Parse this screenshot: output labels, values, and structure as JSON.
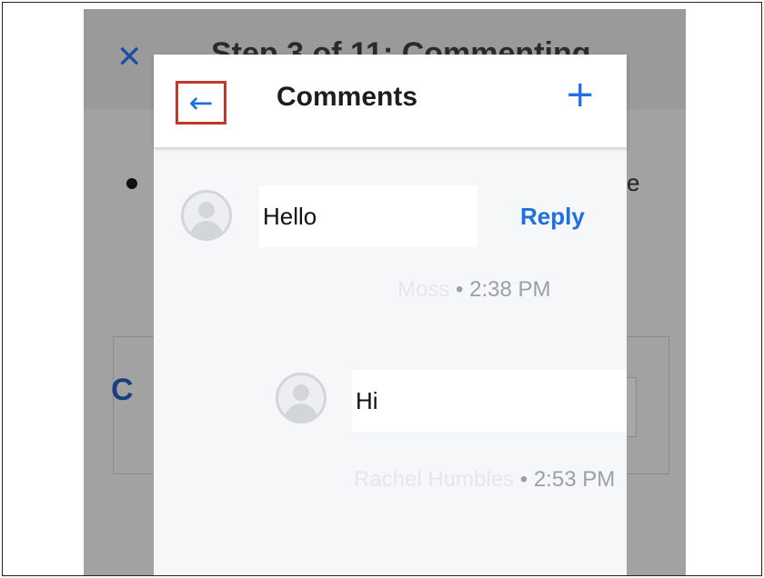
{
  "background_screen": {
    "close_glyph": "✕",
    "title": "Step 3 of 11: Commenting",
    "edge_text": "e",
    "box_letter": "C"
  },
  "comments_panel": {
    "back_glyph": "←",
    "title": "Comments",
    "add_glyph": "+",
    "comments": [
      {
        "text": "Hello",
        "reply_label": "Reply",
        "author": "Moss",
        "separator": "•",
        "time": "2:38 PM"
      },
      {
        "text": "Hi",
        "author": "Rachel Humbles",
        "separator": "•",
        "time": "2:53 PM"
      }
    ]
  },
  "colors": {
    "accent": "#1f6fe0",
    "highlight_border": "#c0392b",
    "overlay_dim": "#9a9a9a"
  },
  "icons": [
    "close-icon",
    "back-arrow-icon",
    "add-icon",
    "avatar-icon"
  ]
}
